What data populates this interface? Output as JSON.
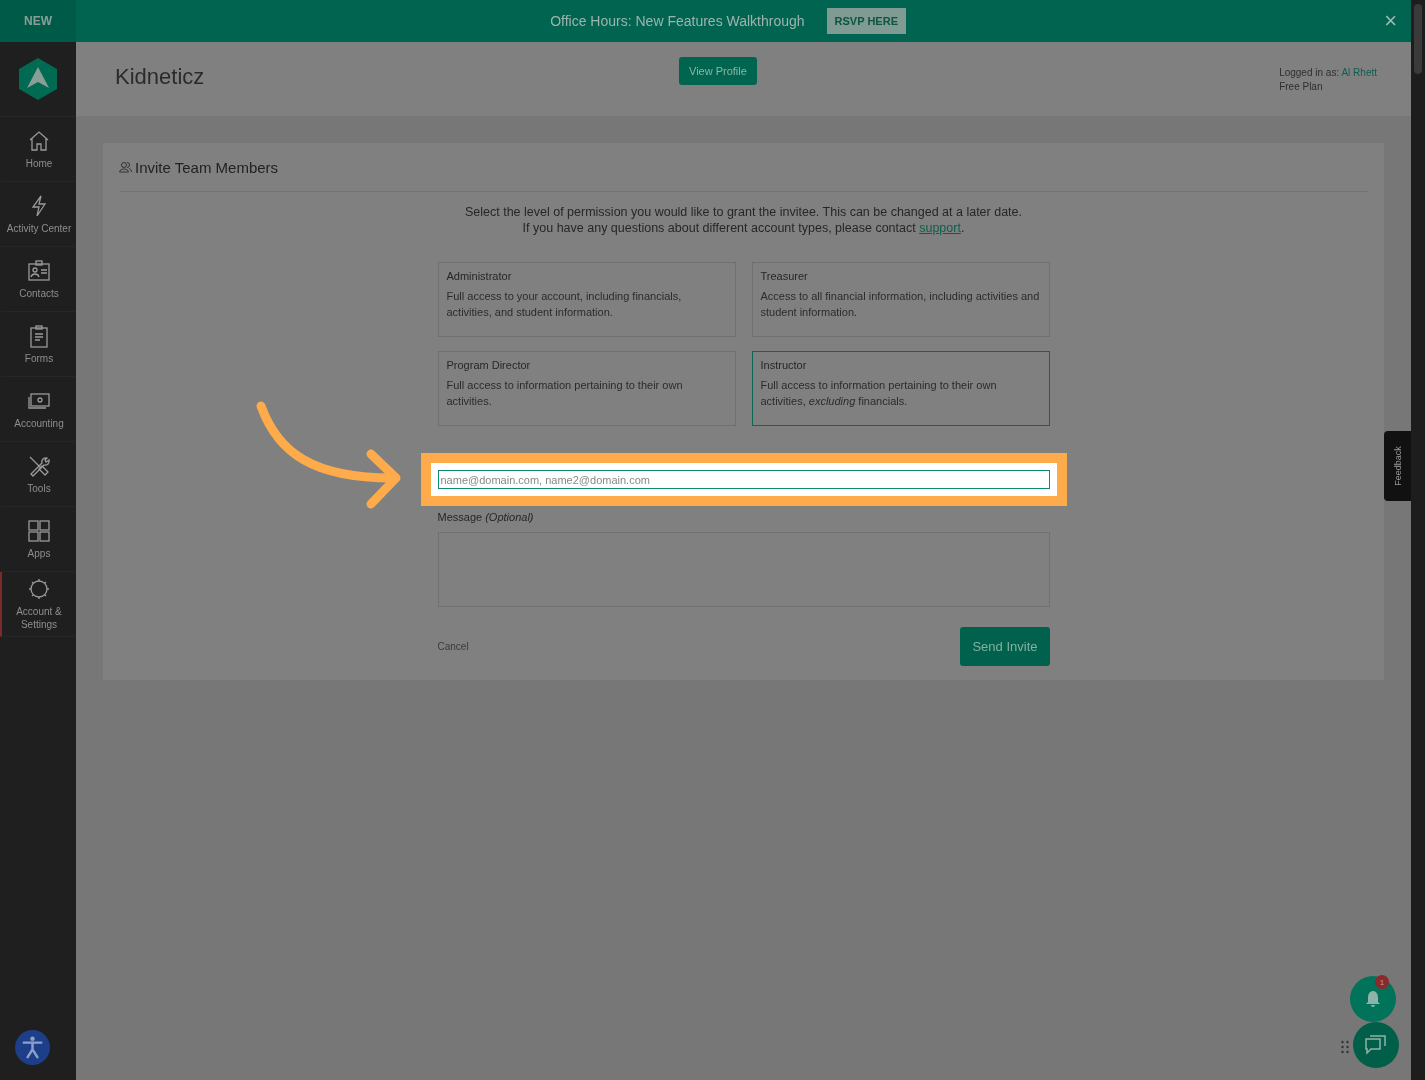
{
  "banner": {
    "tag": "NEW",
    "text": "Office Hours: New Features Walkthrough",
    "button": "RSVP HERE",
    "close": "×"
  },
  "sidebar": {
    "items": [
      {
        "label": "Home",
        "selected": false
      },
      {
        "label": "Activity Center",
        "selected": false
      },
      {
        "label": "Contacts",
        "selected": false
      },
      {
        "label": "Forms",
        "selected": false
      },
      {
        "label": "Accounting",
        "selected": false
      },
      {
        "label": "Tools",
        "selected": false
      },
      {
        "label": "Apps",
        "selected": false
      },
      {
        "label": "Account & Settings",
        "selected": true
      }
    ]
  },
  "header": {
    "title": "Kidneticz",
    "button": "View Profile",
    "logged_in_label": "Logged in as:",
    "user": "Al Rhett",
    "plan": "Free Plan"
  },
  "panel": {
    "title": "Invite Team Members",
    "intro": "Select the level of permission you would like to grant the invitee. This can be changed at a later date.",
    "contact_text": "If you have any questions about different account types, please contact",
    "contact_link": "support",
    "contact_end": ".",
    "roles": [
      {
        "name": "Administrator",
        "description": "Full access to your account, including financials, activities, and student information.",
        "selected": false
      },
      {
        "name": "Treasurer",
        "description": "Access to all financial information, including activities and student information.",
        "selected": false
      },
      {
        "name": "Program Director",
        "description": "Full access to information pertaining to their own activities.",
        "selected": false
      },
      {
        "name": "Instructor",
        "description": "Full access to information pertaining to their own activities, *excluding* financials.",
        "selected": true
      }
    ],
    "emails": {
      "placeholder": "name@domain.com, name2@domain.com"
    },
    "message_label": "Message *(Optional)*",
    "cancel": "Cancel",
    "send": "Send Invite"
  },
  "feedback": "Feedback",
  "notifications": {
    "count": "1"
  }
}
